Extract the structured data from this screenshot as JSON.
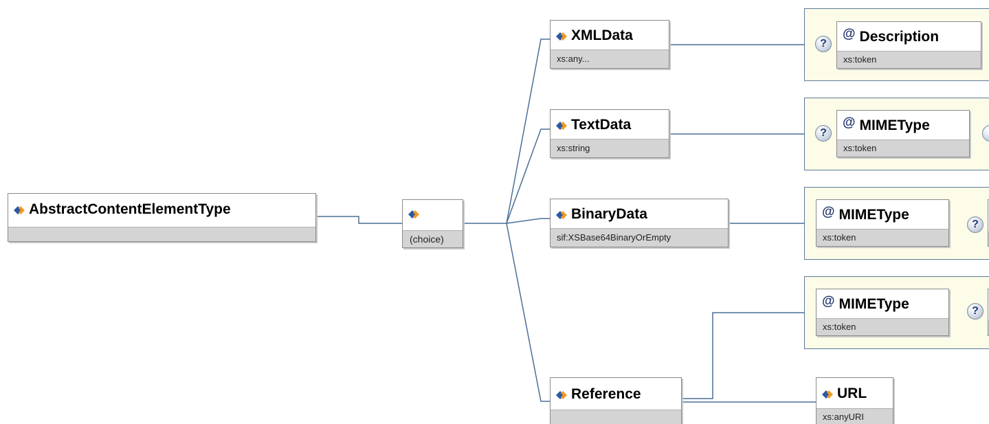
{
  "root": {
    "name": "AbstractContentElementType",
    "type": ""
  },
  "choice": {
    "type": "(choice)"
  },
  "elements": {
    "xmldata": {
      "name": "XMLData",
      "type": "xs:any..."
    },
    "textdata": {
      "name": "TextData",
      "type": "xs:string"
    },
    "binarydata": {
      "name": "BinaryData",
      "type": "sif:XSBase64BinaryOrEmpty"
    },
    "reference": {
      "name": "Reference",
      "type": ""
    },
    "url": {
      "name": "URL",
      "type": "xs:anyURI"
    }
  },
  "attributes": {
    "description": {
      "name": "Description",
      "type": "xs:token"
    },
    "mimetype_text": {
      "name": "MIMEType",
      "type": "xs:token"
    },
    "mimetype_binary": {
      "name": "MIMEType",
      "type": "xs:token"
    },
    "mimetype_reference": {
      "name": "MIMEType",
      "type": "xs:token"
    }
  },
  "optional_marker": "?",
  "attribute_marker": "@",
  "colors": {
    "connector": "#4a6f96",
    "attribute_group_bg": "#fcfce8",
    "type_bar": "#d4d4d4",
    "element_icon_blue": "#2a58a6",
    "element_icon_orange": "#f29a1f"
  }
}
